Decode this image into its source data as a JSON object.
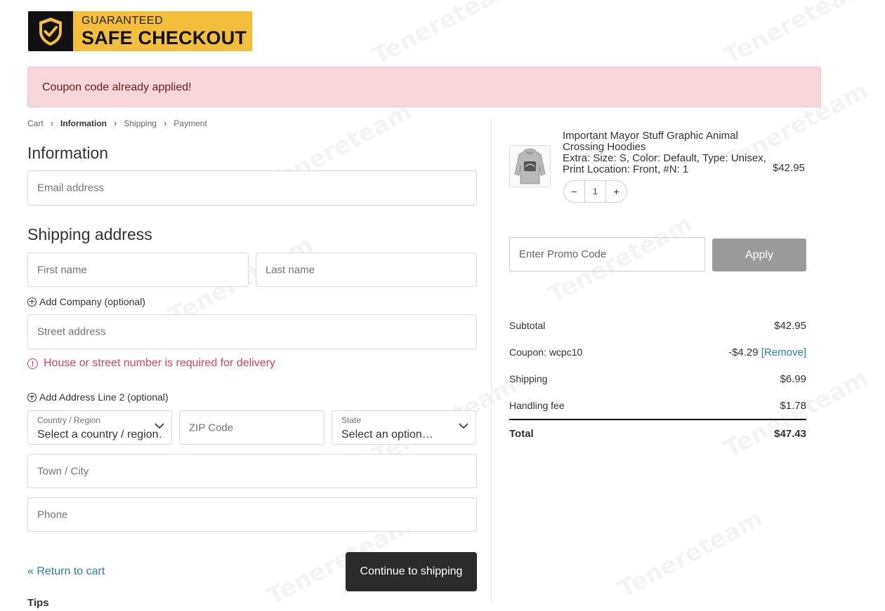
{
  "logo": {
    "line1": "GUARANTEED",
    "line2": "SAFE CHECKOUT"
  },
  "notice": {
    "text": "Coupon code already applied!"
  },
  "breadcrumb": {
    "items": [
      "Cart",
      "Information",
      "Shipping",
      "Payment"
    ],
    "active": "Information"
  },
  "information": {
    "heading": "Information",
    "email_placeholder": "Email address"
  },
  "shipping": {
    "heading": "Shipping address",
    "first_name_placeholder": "First name",
    "last_name_placeholder": "Last name",
    "add_company": "Add Company (optional)",
    "street_placeholder": "Street address",
    "street_error": "House or street number is required for delivery",
    "add_address_line2": "Add Address Line 2 (optional)",
    "country_label": "Country / Region",
    "country_value": "Select a country / region…",
    "zip_placeholder": "ZIP Code",
    "state_label": "State",
    "state_value": "Select an option…",
    "city_placeholder": "Town / City",
    "phone_placeholder": "Phone"
  },
  "actions": {
    "return_link": "« Return to cart",
    "continue_button": "Continue to shipping"
  },
  "tips": "Tips",
  "product": {
    "name": "Important Mayor Stuff Graphic Animal Crossing Hoodies",
    "options": "Extra: Size: S, Color: Default, Type: Unisex, Print Location: Front, #N: 1",
    "price": "$42.95",
    "quantity": "1",
    "qty_minus": "−",
    "qty_plus": "+"
  },
  "promo": {
    "placeholder": "Enter Promo Code",
    "apply_label": "Apply"
  },
  "summary": {
    "subtotal_label": "Subtotal",
    "subtotal_value": "$42.95",
    "coupon_label": "Coupon: wcpc10",
    "coupon_value": "-$4.29",
    "coupon_remove": "[Remove]",
    "shipping_label": "Shipping",
    "shipping_value": "$6.99",
    "handling_label": "Handling fee",
    "handling_value": "$1.78",
    "total_label": "Total",
    "total_value": "$47.43"
  },
  "watermark": "Tenereteam",
  "colors": {
    "notice_bg": "#f8d7da",
    "error": "#e0405a",
    "link": "#2a7fa4",
    "button_dark": "#2b2b2b",
    "apply_bg": "#9a9a9a"
  }
}
